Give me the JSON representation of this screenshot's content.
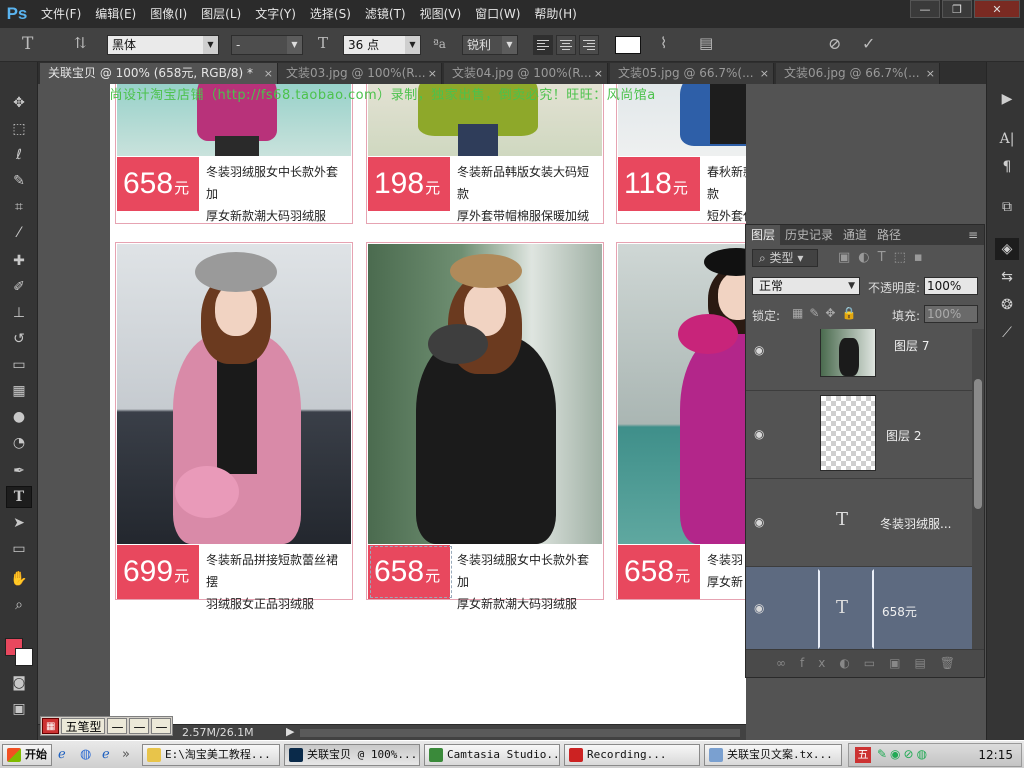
{
  "app": {
    "logo": "Ps"
  },
  "menu": [
    {
      "label": "文件(F)"
    },
    {
      "label": "编辑(E)"
    },
    {
      "label": "图像(I)"
    },
    {
      "label": "图层(L)"
    },
    {
      "label": "文字(Y)"
    },
    {
      "label": "选择(S)"
    },
    {
      "label": "滤镜(T)"
    },
    {
      "label": "视图(V)"
    },
    {
      "label": "窗口(W)"
    },
    {
      "label": "帮助(H)"
    }
  ],
  "window_controls": {
    "minimize": "—",
    "restore": "❐",
    "close": "✕"
  },
  "options": {
    "font_family": "黑体",
    "font_style": "-",
    "font_size": "36 点",
    "aa_icon": "ªa",
    "antialias": "锐利",
    "color": "#ffffff"
  },
  "tabs": [
    {
      "label": "关联宝贝 @ 100% (658元, RGB/8) *",
      "active": true
    },
    {
      "label": "文装03.jpg @ 100%(R..."
    },
    {
      "label": "文装04.jpg @ 100%(R..."
    },
    {
      "label": "文装05.jpg @ 66.7%(..."
    },
    {
      "label": "文装06.jpg @ 66.7%(..."
    }
  ],
  "canvas": {
    "watermark": "风尚设计淘宝店铺（http://fs68.taobao.com）录制，独家出售，倒卖必究！旺旺：风尚馆a"
  },
  "products": [
    {
      "price": "658",
      "unit": "元",
      "desc1": "冬装羽绒服女中长款外套加",
      "desc2": "厚女新款潮大码羽绒服"
    },
    {
      "price": "198",
      "unit": "元",
      "desc1": "冬装新品韩版女装大码短款",
      "desc2": "厚外套带帽棉服保暖加绒"
    },
    {
      "price": "118",
      "unit": "元",
      "desc1": "春秋新款女装雪纺过超薄款",
      "desc2": "短外套休闲韩版夹克衫"
    },
    {
      "price": "699",
      "unit": "元",
      "desc1": "冬装新品拼接短款蕾丝裙摆",
      "desc2": "羽绒服女正品羽绒服"
    },
    {
      "price": "658",
      "unit": "元",
      "desc1": "冬装羽绒服女中长款外套加",
      "desc2": "厚女新款潮大码羽绒服"
    },
    {
      "price": "658",
      "unit": "元",
      "desc1": "冬装羽",
      "desc2": "厚女新"
    }
  ],
  "layers_panel": {
    "tabs": [
      {
        "label": "图层"
      },
      {
        "label": "历史记录"
      },
      {
        "label": "通道"
      },
      {
        "label": "路径"
      }
    ],
    "filter_label": "类型",
    "blend_mode": "正常",
    "opacity_label": "不透明度:",
    "opacity_value": "100%",
    "lock_label": "锁定:",
    "fill_label": "填充:",
    "fill_value": "100%",
    "layers": [
      {
        "name": "图层 7",
        "type": "image"
      },
      {
        "name": "图层 2",
        "type": "empty"
      },
      {
        "name": "冬装羽绒服...",
        "type": "text"
      },
      {
        "name": "658元",
        "type": "text",
        "selected": true
      }
    ],
    "text_glyph": "T"
  },
  "status": {
    "doc_size": "2.57M/26.1M"
  },
  "ime": {
    "mode": "五笔型",
    "b1": "—",
    "b2": "—",
    "b3": "—"
  },
  "taskbar": {
    "start": "开始",
    "items": [
      {
        "label": "E:\\淘宝美工教程..."
      },
      {
        "label": "关联宝贝 @ 100%..."
      },
      {
        "label": "Camtasia Studio..."
      },
      {
        "label": "Recording..."
      },
      {
        "label": "关联宝贝文案.tx..."
      }
    ],
    "tray_ime": "五",
    "clock": "12:15"
  },
  "colors": {
    "price_bg": "#e8485e",
    "card_border": "#e6a3b2",
    "watermark": "#4cc24c",
    "fg_swatch": "#e8485e",
    "selected_layer": "#5d6a80"
  }
}
